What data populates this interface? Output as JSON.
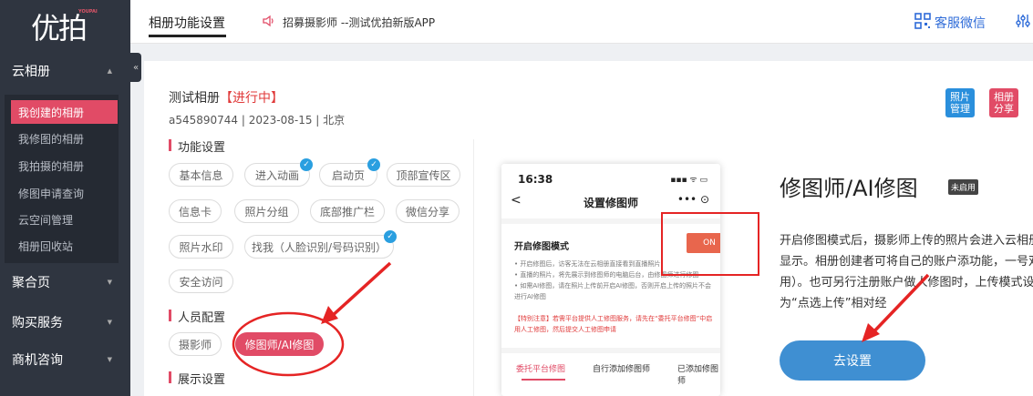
{
  "brand": {
    "logo_text": "优拍",
    "mini": "YOUPAI"
  },
  "sidebar": {
    "sections": [
      {
        "label": "云相册",
        "caret": "▲"
      },
      {
        "label": "聚合页",
        "caret": "▼"
      },
      {
        "label": "购买服务",
        "caret": "▼"
      },
      {
        "label": "商机咨询",
        "caret": "▼"
      }
    ],
    "items": [
      {
        "label": "我创建的相册"
      },
      {
        "label": "我修图的相册"
      },
      {
        "label": "我拍摄的相册"
      },
      {
        "label": "修图申请查询"
      },
      {
        "label": "云空间管理"
      },
      {
        "label": "相册回收站"
      }
    ],
    "collapse": "«"
  },
  "topbar": {
    "page_tab": "相册功能设置",
    "announcement": "招募摄影师 --测试优拍新版APP",
    "service": "客服微信"
  },
  "album": {
    "title": "测试相册",
    "status": "【进行中】",
    "meta": "a545890744  |  2023-08-15  |  北京"
  },
  "actions": {
    "photo_manage": "照片管理",
    "album_share": "相册分享"
  },
  "sections": {
    "function": "功能设置",
    "staff": "人员配置",
    "display": "展示设置"
  },
  "function_chips": [
    {
      "label": "基本信息"
    },
    {
      "label": "进入动画"
    },
    {
      "label": "启动页"
    },
    {
      "label": "顶部宣传区"
    },
    {
      "label": "信息卡"
    },
    {
      "label": "照片分组"
    },
    {
      "label": "底部推广栏"
    },
    {
      "label": "微信分享"
    },
    {
      "label": "照片水印"
    },
    {
      "label": "找我（人脸识别/号码识别）"
    },
    {
      "label": "安全访问"
    }
  ],
  "staff_chips": [
    {
      "label": "摄影师"
    },
    {
      "label": "修图师/AI修图"
    }
  ],
  "phone": {
    "time": "16:38",
    "status": "▪▪▪ ᯤ ▭",
    "back": "<",
    "title": "设置修图师",
    "more": "•••  ⊙",
    "mode_label": "开启修图模式",
    "on": "ON",
    "desc": "• 开启修图后，访客无法在云相册直接看到直播照片\n• 直播的照片，将先展示到修图师的电脑后台，由修图师进行修图\n• 如需AI修图，请在照片上传前开启AI修图，否则开启上传的照片不会进行AI修图",
    "note": "【特别注意】若需平台提供人工修图服务，请先在“委托平台修图”中启用人工修图，然后提交人工修图申请",
    "tabs": [
      "委托平台修图",
      "自行添加修图师",
      "已添加修图师"
    ]
  },
  "feature": {
    "title": "修图师/AI修图",
    "badge": "未启用",
    "desc": "开启修图模式后，摄影师上传的照片会进入云相册显示。相册创建者可将自己的账户添功能，一号双用）。也可另行注册账户做人修图时，上传模式设为“点选上传”相对经",
    "button": "去设置"
  },
  "colors": {
    "accent": "#e14b66",
    "blue": "#3f8fd2",
    "sidebar": "#2f3540",
    "annotation": "#e52424"
  }
}
